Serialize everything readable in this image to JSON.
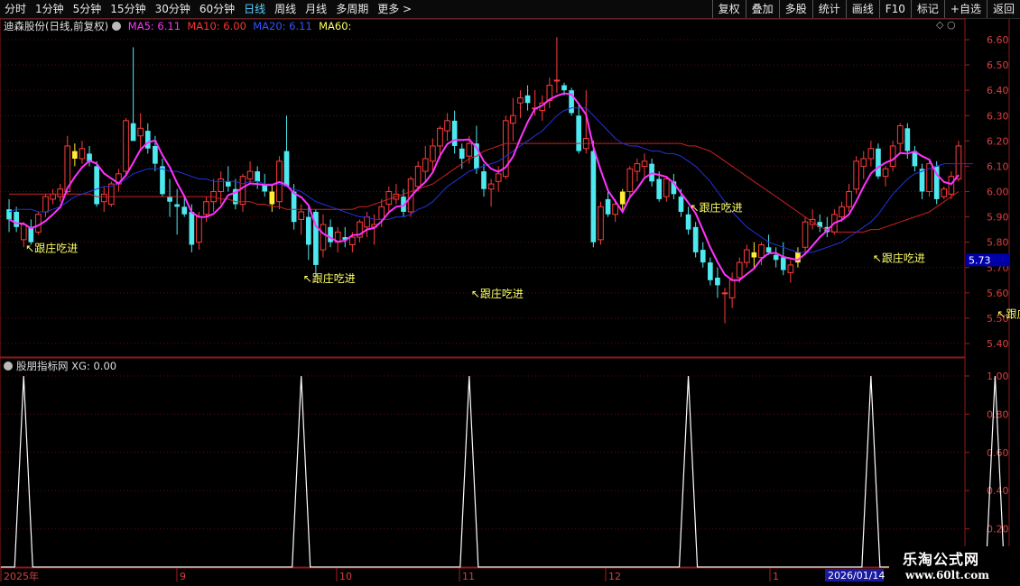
{
  "toolbar": {
    "periods": [
      "分时",
      "1分钟",
      "5分钟",
      "15分钟",
      "30分钟",
      "60分钟",
      "日线",
      "周线",
      "月线",
      "多周期",
      "更多 >"
    ],
    "active_period": 6,
    "tools": [
      "复权",
      "叠加",
      "多股",
      "统计",
      "画线",
      "F10",
      "标记",
      "+自选",
      "返回"
    ]
  },
  "legend": {
    "stock": "迪森股份(日线,前复权)",
    "ma5": "MA5: 6.11",
    "ma10": "MA10: 6.00",
    "ma20": "MA20: 6.11",
    "ma60": "MA60:",
    "colors": {
      "ma5": "#ff33ff",
      "ma10": "#ff3333",
      "ma20": "#3355ff",
      "ma60": "#ffff66"
    }
  },
  "price_axis": {
    "ticks": [
      "6.60",
      "6.50",
      "6.40",
      "6.30",
      "6.20",
      "6.10",
      "6.00",
      "5.90",
      "5.80",
      "5.70",
      "5.60",
      "5.50",
      "5.40"
    ],
    "current": "5.73"
  },
  "indicator": {
    "title": "股朋指标网 XG: 0.00",
    "ticks": [
      "1.00",
      "0.80",
      "0.60",
      "0.40",
      "0.20"
    ]
  },
  "signal_label": "跟庄吃进",
  "date_axis": {
    "labels": [
      "2025年",
      "9",
      "10",
      "11",
      "12",
      "1"
    ],
    "current": "2026/01/14"
  },
  "brand": {
    "name": "乐淘公式网",
    "url": "www.60lt.com"
  },
  "chart_data": {
    "type": "candlestick",
    "title": "迪森股份(日线,前复权)",
    "ylim": [
      5.35,
      6.65
    ],
    "candles": [
      {
        "o": 5.93,
        "h": 5.97,
        "l": 5.84,
        "c": 5.89
      },
      {
        "o": 5.92,
        "h": 5.94,
        "l": 5.84,
        "c": 5.86
      },
      {
        "o": 5.81,
        "h": 5.88,
        "l": 5.78,
        "c": 5.87
      },
      {
        "o": 5.86,
        "h": 5.89,
        "l": 5.79,
        "c": 5.8
      },
      {
        "o": 5.84,
        "h": 5.92,
        "l": 5.83,
        "c": 5.91
      },
      {
        "o": 5.92,
        "h": 5.99,
        "l": 5.9,
        "c": 5.98
      },
      {
        "o": 5.97,
        "h": 6.01,
        "l": 5.95,
        "c": 5.99
      },
      {
        "o": 5.98,
        "h": 6.03,
        "l": 5.96,
        "c": 6.01
      },
      {
        "o": 6.0,
        "h": 6.22,
        "l": 5.99,
        "c": 6.18
      },
      {
        "o": 6.16,
        "h": 6.19,
        "l": 6.1,
        "c": 6.13
      },
      {
        "o": 6.13,
        "h": 6.2,
        "l": 6.11,
        "c": 6.17
      },
      {
        "o": 6.15,
        "h": 6.18,
        "l": 6.1,
        "c": 6.12
      },
      {
        "o": 6.1,
        "h": 6.12,
        "l": 5.94,
        "c": 5.95
      },
      {
        "o": 5.96,
        "h": 6.02,
        "l": 5.92,
        "c": 5.99
      },
      {
        "o": 5.95,
        "h": 6.04,
        "l": 5.94,
        "c": 6.03
      },
      {
        "o": 6.03,
        "h": 6.09,
        "l": 6.0,
        "c": 6.07
      },
      {
        "o": 6.08,
        "h": 6.29,
        "l": 6.06,
        "c": 6.28
      },
      {
        "o": 6.27,
        "h": 6.57,
        "l": 6.2,
        "c": 6.2
      },
      {
        "o": 6.22,
        "h": 6.31,
        "l": 6.16,
        "c": 6.25
      },
      {
        "o": 6.24,
        "h": 6.27,
        "l": 6.15,
        "c": 6.17
      },
      {
        "o": 6.18,
        "h": 6.22,
        "l": 6.08,
        "c": 6.11
      },
      {
        "o": 6.1,
        "h": 6.13,
        "l": 5.98,
        "c": 5.99
      },
      {
        "o": 5.98,
        "h": 6.05,
        "l": 5.9,
        "c": 5.96
      },
      {
        "o": 5.95,
        "h": 6.01,
        "l": 5.83,
        "c": 5.94
      },
      {
        "o": 5.94,
        "h": 5.98,
        "l": 5.9,
        "c": 5.91
      },
      {
        "o": 5.92,
        "h": 5.95,
        "l": 5.76,
        "c": 5.79
      },
      {
        "o": 5.8,
        "h": 5.92,
        "l": 5.77,
        "c": 5.9
      },
      {
        "o": 5.91,
        "h": 5.98,
        "l": 5.88,
        "c": 5.96
      },
      {
        "o": 5.96,
        "h": 6.05,
        "l": 5.92,
        "c": 6.0
      },
      {
        "o": 6.0,
        "h": 6.08,
        "l": 5.95,
        "c": 6.05
      },
      {
        "o": 6.04,
        "h": 6.1,
        "l": 6.0,
        "c": 6.02
      },
      {
        "o": 6.01,
        "h": 6.05,
        "l": 5.93,
        "c": 5.95
      },
      {
        "o": 5.95,
        "h": 6.07,
        "l": 5.92,
        "c": 6.06
      },
      {
        "o": 6.05,
        "h": 6.12,
        "l": 6.03,
        "c": 6.08
      },
      {
        "o": 6.08,
        "h": 6.1,
        "l": 6.01,
        "c": 6.04
      },
      {
        "o": 6.03,
        "h": 6.07,
        "l": 5.98,
        "c": 6.0
      },
      {
        "o": 6.0,
        "h": 6.03,
        "l": 5.92,
        "c": 5.95
      },
      {
        "o": 5.96,
        "h": 6.14,
        "l": 5.93,
        "c": 6.12
      },
      {
        "o": 6.16,
        "h": 6.3,
        "l": 6.13,
        "c": 6.02
      },
      {
        "o": 6.0,
        "h": 6.03,
        "l": 5.85,
        "c": 5.88
      },
      {
        "o": 5.89,
        "h": 5.95,
        "l": 5.83,
        "c": 5.92
      },
      {
        "o": 5.9,
        "h": 5.94,
        "l": 5.73,
        "c": 5.79
      },
      {
        "o": 5.92,
        "h": 5.93,
        "l": 5.66,
        "c": 5.71
      },
      {
        "o": 5.77,
        "h": 5.91,
        "l": 5.74,
        "c": 5.87
      },
      {
        "o": 5.86,
        "h": 5.89,
        "l": 5.78,
        "c": 5.8
      },
      {
        "o": 5.8,
        "h": 5.86,
        "l": 5.76,
        "c": 5.84
      },
      {
        "o": 5.82,
        "h": 5.86,
        "l": 5.78,
        "c": 5.81
      },
      {
        "o": 5.79,
        "h": 5.84,
        "l": 5.76,
        "c": 5.82
      },
      {
        "o": 5.82,
        "h": 5.89,
        "l": 5.8,
        "c": 5.88
      },
      {
        "o": 5.86,
        "h": 5.92,
        "l": 5.82,
        "c": 5.9
      },
      {
        "o": 5.86,
        "h": 5.91,
        "l": 5.79,
        "c": 5.87
      },
      {
        "o": 5.89,
        "h": 5.97,
        "l": 5.86,
        "c": 5.94
      },
      {
        "o": 5.95,
        "h": 6.02,
        "l": 5.92,
        "c": 6.0
      },
      {
        "o": 5.97,
        "h": 6.03,
        "l": 5.95,
        "c": 5.99
      },
      {
        "o": 5.98,
        "h": 6.01,
        "l": 5.9,
        "c": 5.92
      },
      {
        "o": 5.92,
        "h": 6.06,
        "l": 5.9,
        "c": 6.05
      },
      {
        "o": 6.02,
        "h": 6.12,
        "l": 6.0,
        "c": 6.1
      },
      {
        "o": 6.08,
        "h": 6.18,
        "l": 6.04,
        "c": 6.13
      },
      {
        "o": 6.12,
        "h": 6.21,
        "l": 6.08,
        "c": 6.18
      },
      {
        "o": 6.18,
        "h": 6.26,
        "l": 6.13,
        "c": 6.25
      },
      {
        "o": 6.24,
        "h": 6.31,
        "l": 6.2,
        "c": 6.28
      },
      {
        "o": 6.28,
        "h": 6.32,
        "l": 6.15,
        "c": 6.18
      },
      {
        "o": 6.17,
        "h": 6.19,
        "l": 6.09,
        "c": 6.13
      },
      {
        "o": 6.14,
        "h": 6.22,
        "l": 6.11,
        "c": 6.19
      },
      {
        "o": 6.19,
        "h": 6.26,
        "l": 6.07,
        "c": 6.09
      },
      {
        "o": 6.08,
        "h": 6.11,
        "l": 5.98,
        "c": 6.01
      },
      {
        "o": 6.01,
        "h": 6.05,
        "l": 5.94,
        "c": 6.03
      },
      {
        "o": 6.04,
        "h": 6.1,
        "l": 6.0,
        "c": 6.07
      },
      {
        "o": 6.06,
        "h": 6.3,
        "l": 6.05,
        "c": 6.28
      },
      {
        "o": 6.27,
        "h": 6.37,
        "l": 6.2,
        "c": 6.3
      },
      {
        "o": 6.35,
        "h": 6.4,
        "l": 6.29,
        "c": 6.37
      },
      {
        "o": 6.38,
        "h": 6.42,
        "l": 6.32,
        "c": 6.35
      },
      {
        "o": 6.33,
        "h": 6.4,
        "l": 6.3,
        "c": 6.33
      },
      {
        "o": 6.32,
        "h": 6.38,
        "l": 6.28,
        "c": 6.35
      },
      {
        "o": 6.36,
        "h": 6.45,
        "l": 6.33,
        "c": 6.42
      },
      {
        "o": 6.44,
        "h": 6.61,
        "l": 6.39,
        "c": 6.44
      },
      {
        "o": 6.42,
        "h": 6.43,
        "l": 6.38,
        "c": 6.4
      },
      {
        "o": 6.4,
        "h": 6.41,
        "l": 6.3,
        "c": 6.31
      },
      {
        "o": 6.3,
        "h": 6.35,
        "l": 6.15,
        "c": 6.16
      },
      {
        "o": 6.17,
        "h": 6.4,
        "l": 6.15,
        "c": 6.21
      },
      {
        "o": 6.16,
        "h": 6.2,
        "l": 5.78,
        "c": 5.8
      },
      {
        "o": 5.81,
        "h": 5.96,
        "l": 5.79,
        "c": 5.94
      },
      {
        "o": 5.97,
        "h": 6.0,
        "l": 5.9,
        "c": 5.91
      },
      {
        "o": 5.91,
        "h": 5.97,
        "l": 5.88,
        "c": 5.95
      },
      {
        "o": 5.95,
        "h": 6.01,
        "l": 5.92,
        "c": 6.0
      },
      {
        "o": 6.0,
        "h": 6.1,
        "l": 5.98,
        "c": 6.09
      },
      {
        "o": 6.08,
        "h": 6.13,
        "l": 6.04,
        "c": 6.11
      },
      {
        "o": 6.1,
        "h": 6.15,
        "l": 6.06,
        "c": 6.12
      },
      {
        "o": 6.11,
        "h": 6.13,
        "l": 6.02,
        "c": 6.04
      },
      {
        "o": 6.05,
        "h": 6.08,
        "l": 5.96,
        "c": 5.97
      },
      {
        "o": 5.98,
        "h": 6.06,
        "l": 5.96,
        "c": 6.05
      },
      {
        "o": 6.04,
        "h": 6.07,
        "l": 5.97,
        "c": 5.99
      },
      {
        "o": 5.98,
        "h": 6.01,
        "l": 5.9,
        "c": 5.92
      },
      {
        "o": 5.91,
        "h": 5.94,
        "l": 5.83,
        "c": 5.85
      },
      {
        "o": 5.86,
        "h": 5.88,
        "l": 5.74,
        "c": 5.76
      },
      {
        "o": 5.77,
        "h": 5.8,
        "l": 5.7,
        "c": 5.72
      },
      {
        "o": 5.72,
        "h": 5.74,
        "l": 5.63,
        "c": 5.65
      },
      {
        "o": 5.66,
        "h": 5.7,
        "l": 5.58,
        "c": 5.63
      },
      {
        "o": 5.6,
        "h": 5.62,
        "l": 5.48,
        "c": 5.6
      },
      {
        "o": 5.58,
        "h": 5.68,
        "l": 5.54,
        "c": 5.65
      },
      {
        "o": 5.66,
        "h": 5.74,
        "l": 5.64,
        "c": 5.72
      },
      {
        "o": 5.72,
        "h": 5.79,
        "l": 5.7,
        "c": 5.77
      },
      {
        "o": 5.76,
        "h": 5.8,
        "l": 5.7,
        "c": 5.74
      },
      {
        "o": 5.74,
        "h": 5.8,
        "l": 5.71,
        "c": 5.79
      },
      {
        "o": 5.78,
        "h": 5.83,
        "l": 5.75,
        "c": 5.76
      },
      {
        "o": 5.75,
        "h": 5.78,
        "l": 5.7,
        "c": 5.73
      },
      {
        "o": 5.74,
        "h": 5.8,
        "l": 5.67,
        "c": 5.69
      },
      {
        "o": 5.68,
        "h": 5.73,
        "l": 5.64,
        "c": 5.71
      },
      {
        "o": 5.72,
        "h": 5.78,
        "l": 5.7,
        "c": 5.76
      },
      {
        "o": 5.78,
        "h": 5.9,
        "l": 5.76,
        "c": 5.88
      },
      {
        "o": 5.87,
        "h": 5.93,
        "l": 5.85,
        "c": 5.89
      },
      {
        "o": 5.88,
        "h": 5.91,
        "l": 5.84,
        "c": 5.86
      },
      {
        "o": 5.86,
        "h": 5.9,
        "l": 5.82,
        "c": 5.84
      },
      {
        "o": 5.84,
        "h": 5.93,
        "l": 5.83,
        "c": 5.91
      },
      {
        "o": 5.9,
        "h": 5.96,
        "l": 5.88,
        "c": 5.94
      },
      {
        "o": 5.94,
        "h": 6.03,
        "l": 5.92,
        "c": 6.0
      },
      {
        "o": 6.01,
        "h": 6.14,
        "l": 5.99,
        "c": 6.12
      },
      {
        "o": 6.1,
        "h": 6.16,
        "l": 6.05,
        "c": 6.13
      },
      {
        "o": 6.13,
        "h": 6.2,
        "l": 6.1,
        "c": 6.17
      },
      {
        "o": 6.17,
        "h": 6.19,
        "l": 6.05,
        "c": 6.06
      },
      {
        "o": 6.06,
        "h": 6.1,
        "l": 6.02,
        "c": 6.09
      },
      {
        "o": 6.1,
        "h": 6.2,
        "l": 6.08,
        "c": 6.18
      },
      {
        "o": 6.19,
        "h": 6.27,
        "l": 6.15,
        "c": 6.26
      },
      {
        "o": 6.25,
        "h": 6.27,
        "l": 6.13,
        "c": 6.16
      },
      {
        "o": 6.16,
        "h": 6.18,
        "l": 6.08,
        "c": 6.1
      },
      {
        "o": 6.09,
        "h": 6.11,
        "l": 5.97,
        "c": 6.0
      },
      {
        "o": 6.0,
        "h": 6.13,
        "l": 5.98,
        "c": 6.11
      },
      {
        "o": 6.1,
        "h": 6.12,
        "l": 5.95,
        "c": 5.97
      },
      {
        "o": 5.98,
        "h": 6.02,
        "l": 5.97,
        "c": 6.01
      },
      {
        "o": 5.99,
        "h": 6.08,
        "l": 5.97,
        "c": 6.06
      },
      {
        "o": 6.05,
        "h": 6.2,
        "l": 6.04,
        "c": 6.18
      }
    ],
    "signals": [
      9,
      36,
      84,
      102,
      108,
      142,
      148
    ],
    "labels_at": [
      [
        2,
        5.84
      ],
      [
        40,
        5.72
      ],
      [
        63,
        5.66
      ],
      [
        93,
        6.0
      ],
      [
        118,
        5.8
      ],
      [
        135,
        5.58
      ],
      [
        155,
        5.6
      ],
      [
        187,
        5.91
      ]
    ],
    "ma20": [
      5.92,
      5.93,
      5.93,
      5.93,
      5.92,
      5.92,
      5.93,
      5.94,
      5.96,
      5.98,
      5.99,
      6.0,
      6.01,
      6.02,
      6.02,
      6.03,
      6.05,
      6.07,
      6.08,
      6.09,
      6.09,
      6.09,
      6.08,
      6.08,
      6.07,
      6.06,
      6.05,
      6.05,
      6.04,
      6.04,
      6.04,
      6.04,
      6.03,
      6.04,
      6.04,
      6.03,
      6.03,
      6.03,
      6.02,
      6.01,
      6.0,
      5.98,
      5.96,
      5.95,
      5.94,
      5.93,
      5.92,
      5.91,
      5.9,
      5.9,
      5.89,
      5.89,
      5.89,
      5.9,
      5.9,
      5.91,
      5.93,
      5.94,
      5.96,
      5.99,
      6.02,
      6.04,
      6.06,
      6.08,
      6.09,
      6.1,
      6.11,
      6.12,
      6.14,
      6.16,
      6.18,
      6.2,
      6.22,
      6.24,
      6.27,
      6.3,
      6.32,
      6.33,
      6.33,
      6.33,
      6.3,
      6.27,
      6.24,
      6.21,
      6.19,
      6.18,
      6.18,
      6.17,
      6.16,
      6.16,
      6.15,
      6.15,
      6.14,
      6.12,
      6.1,
      6.07,
      6.04,
      6.0,
      5.96,
      5.92,
      5.89,
      5.86,
      5.84,
      5.82,
      5.8,
      5.79,
      5.78,
      5.77,
      5.76,
      5.76,
      5.76,
      5.77,
      5.78,
      5.79,
      5.8,
      5.82,
      5.84,
      5.86,
      5.88,
      5.91,
      5.95,
      5.99,
      6.02,
      6.05,
      6.07,
      6.08,
      6.09,
      6.1,
      6.11,
      6.11,
      6.11,
      6.11,
      6.11
    ],
    "ma60": [
      5.99,
      5.99,
      5.99,
      5.99,
      5.99,
      5.99,
      5.99,
      5.99,
      5.99,
      5.99,
      5.99,
      5.99,
      5.98,
      5.98,
      5.98,
      5.98,
      5.98,
      5.98,
      5.98,
      5.98,
      5.98,
      5.98,
      5.98,
      5.98,
      5.98,
      5.98,
      5.98,
      5.98,
      5.98,
      5.97,
      5.97,
      5.96,
      5.96,
      5.96,
      5.95,
      5.95,
      5.94,
      5.94,
      5.93,
      5.93,
      5.93,
      5.93,
      5.93,
      5.93,
      5.93,
      5.93,
      5.93,
      5.93,
      5.94,
      5.94,
      5.95,
      5.96,
      5.97,
      5.98,
      5.99,
      6.0,
      6.01,
      6.02,
      6.03,
      6.05,
      6.07,
      6.09,
      6.11,
      6.13,
      6.14,
      6.16,
      6.17,
      6.18,
      6.19,
      6.19,
      6.19,
      6.19,
      6.19,
      6.19,
      6.19,
      6.19,
      6.19,
      6.19,
      6.19,
      6.19,
      6.19,
      6.19,
      6.19,
      6.19,
      6.19,
      6.19,
      6.19,
      6.19,
      6.19,
      6.19,
      6.19,
      6.19,
      6.19,
      6.18,
      6.18,
      6.17,
      6.16,
      6.14,
      6.12,
      6.1,
      6.08,
      6.06,
      6.04,
      6.02,
      6.0,
      5.98,
      5.96,
      5.94,
      5.92,
      5.9,
      5.88,
      5.86,
      5.85,
      5.84,
      5.84,
      5.84,
      5.84,
      5.84,
      5.85,
      5.85,
      5.86,
      5.87,
      5.88,
      5.89,
      5.9,
      5.91,
      5.92,
      5.94,
      5.96,
      5.98,
      6.0
    ]
  }
}
